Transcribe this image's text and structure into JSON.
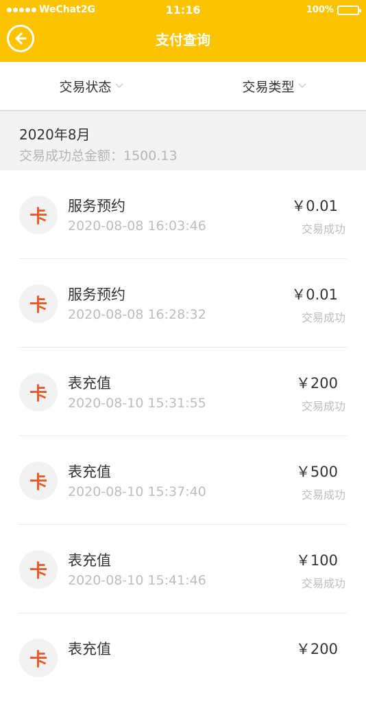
{
  "status_bar": {
    "carrier": "WeChat2G",
    "time": "11:16",
    "battery": "100%"
  },
  "header": {
    "title": "支付查询",
    "back_icon": "back-arrow-icon"
  },
  "filters": {
    "status_label": "交易状态",
    "type_label": "交易类型"
  },
  "summary": {
    "month": "2020年8月",
    "total": "交易成功总金额：1500.13"
  },
  "transactions": [
    {
      "avatar": "卡",
      "name": "服务预约",
      "date": "2020-08-08 16:03:46",
      "amount": "￥0.01",
      "status": "交易成功"
    },
    {
      "avatar": "卡",
      "name": "服务预约",
      "date": "2020-08-08 16:28:32",
      "amount": "￥0.01",
      "status": "交易成功"
    },
    {
      "avatar": "卡",
      "name": "表充值",
      "date": "2020-08-10 15:31:55",
      "amount": "￥200",
      "status": "交易成功"
    },
    {
      "avatar": "卡",
      "name": "表充值",
      "date": "2020-08-10 15:37:40",
      "amount": "￥500",
      "status": "交易成功"
    },
    {
      "avatar": "卡",
      "name": "表充值",
      "date": "2020-08-10 15:41:46",
      "amount": "￥100",
      "status": "交易成功"
    },
    {
      "avatar": "卡",
      "name": "表充值",
      "date": "",
      "amount": "￥200",
      "status": ""
    }
  ],
  "colors": {
    "accent": "#fcc400",
    "card_icon": "#e85a2a"
  }
}
